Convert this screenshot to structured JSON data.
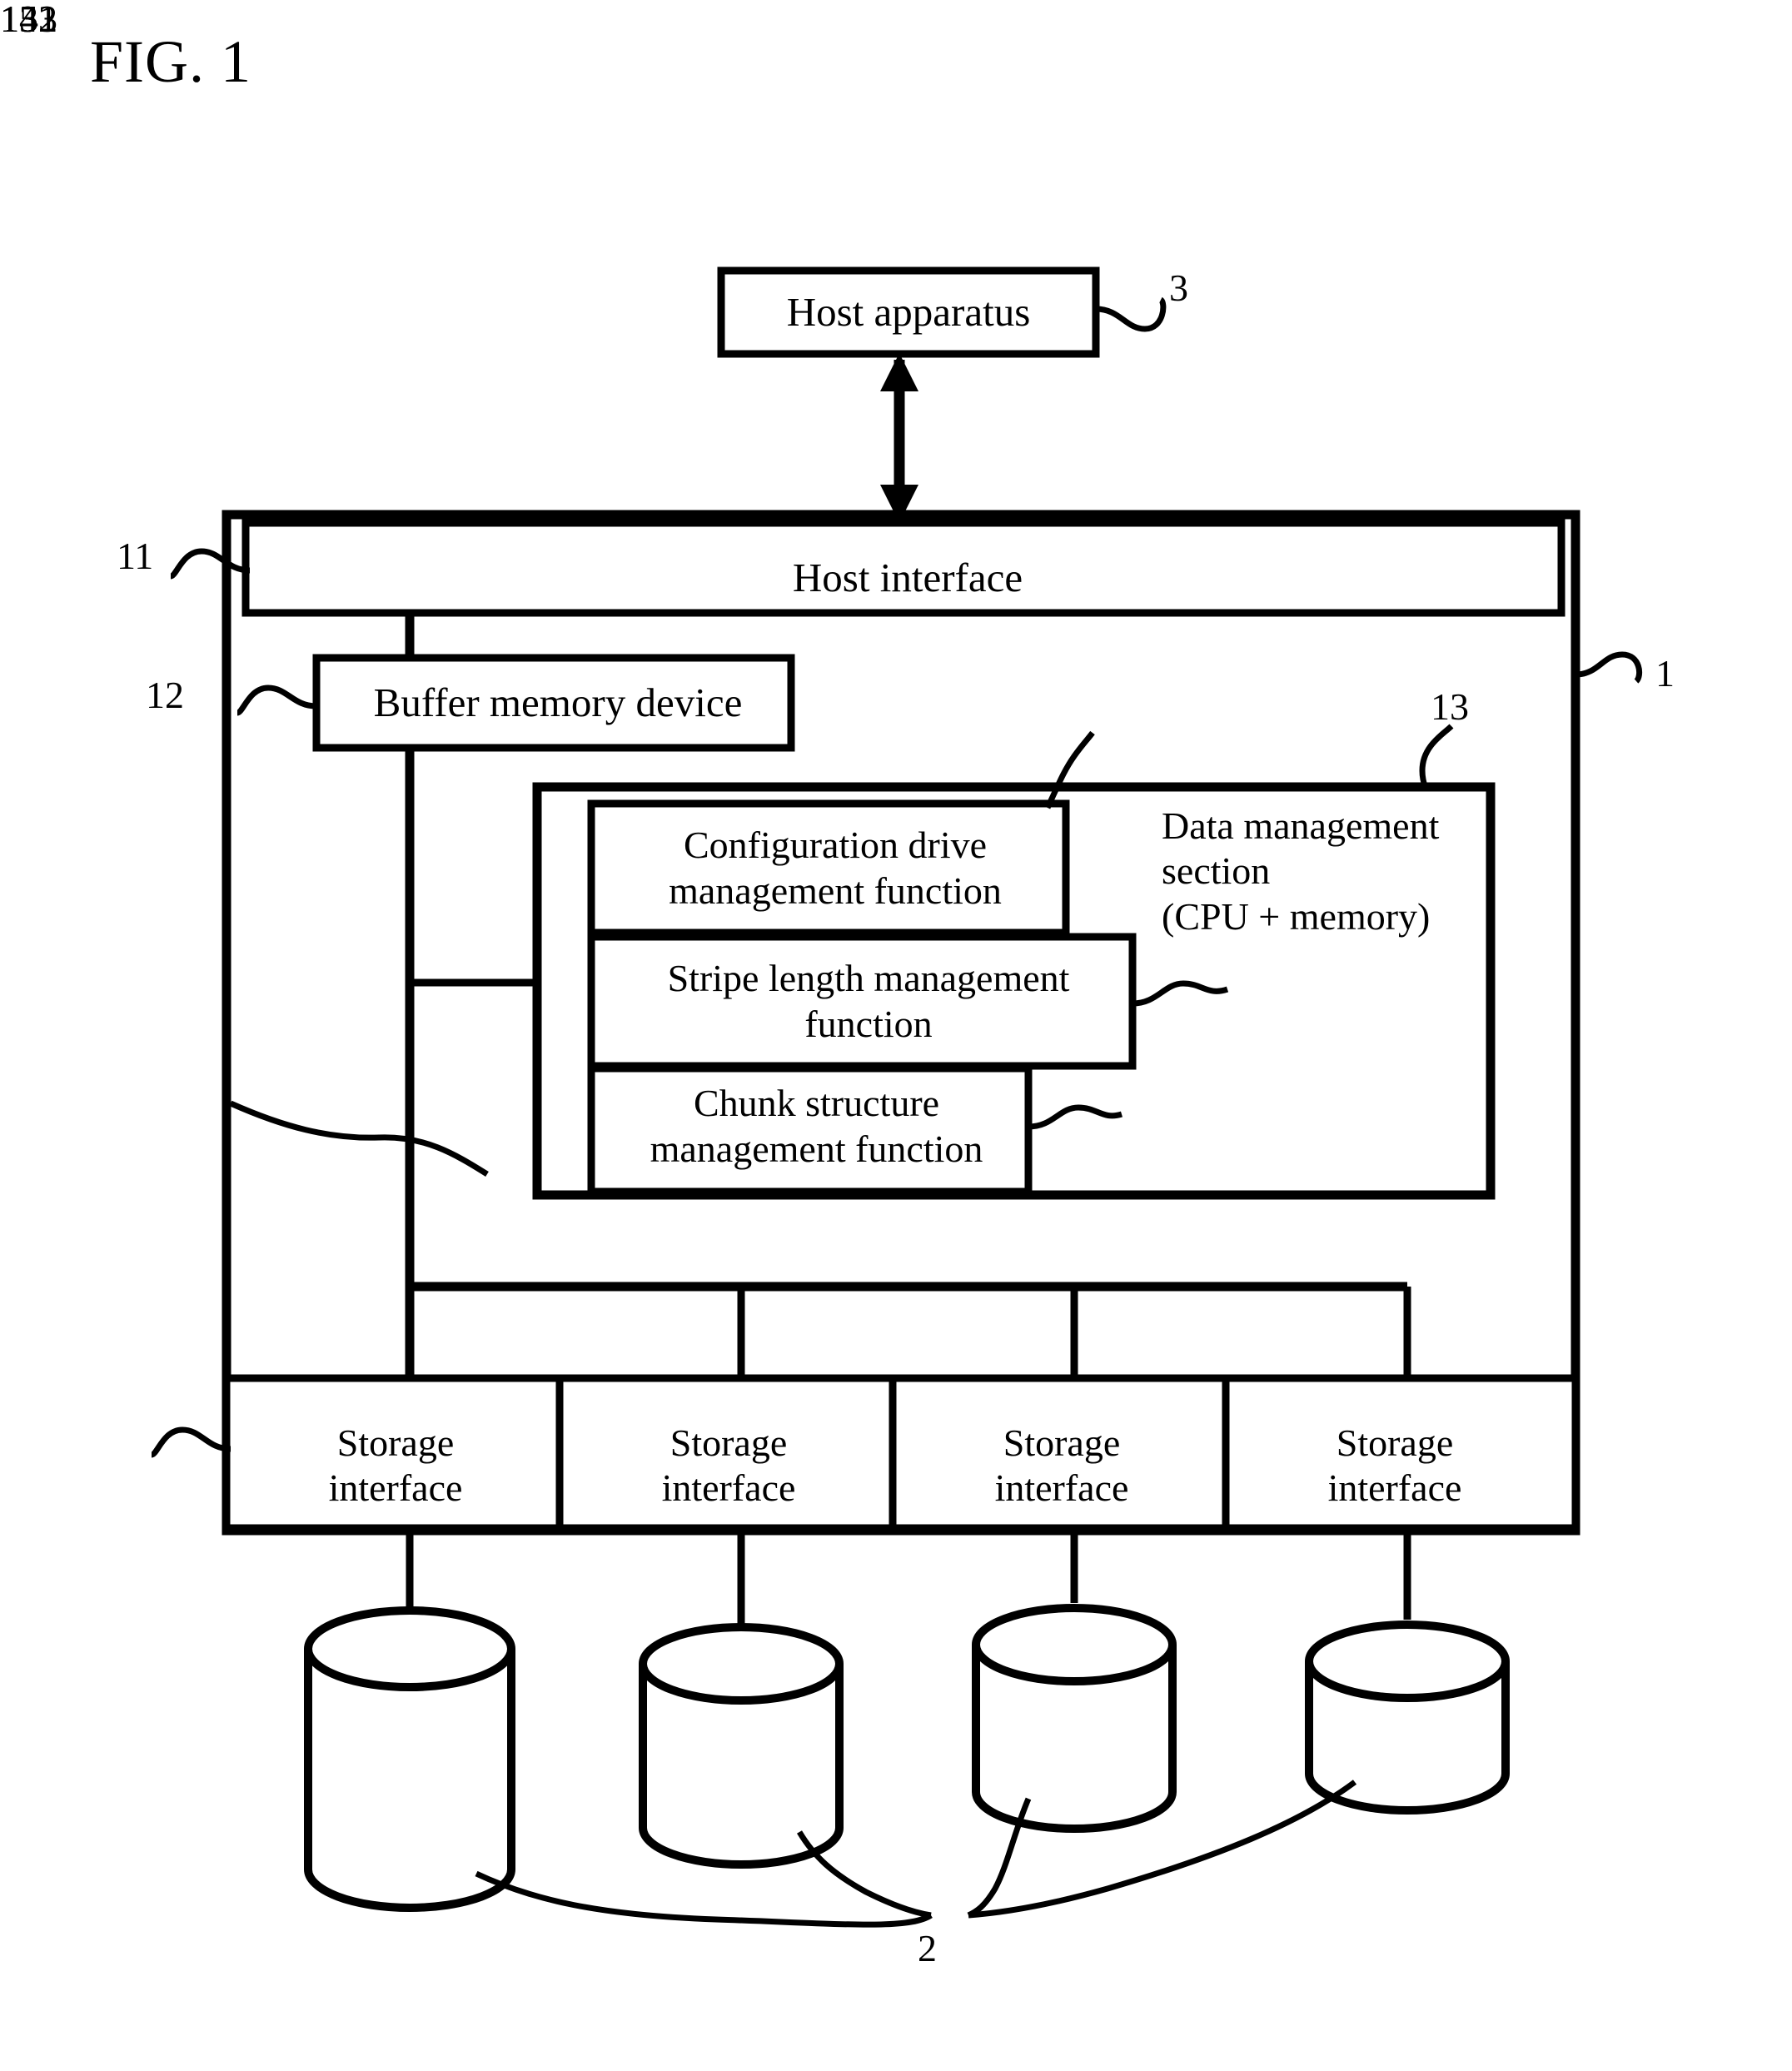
{
  "figure": {
    "title": "FIG. 1"
  },
  "blocks": {
    "host_apparatus": "Host apparatus",
    "host_interface": "Host interface",
    "buffer_memory_device": "Buffer memory device",
    "data_management_section": "Data management\nsection\n(CPU + memory)",
    "configuration_drive_management_function": "Configuration drive\nmanagement function",
    "stripe_length_management_function": "Stripe length management\nfunction",
    "chunk_structure_management_function": "Chunk structure\nmanagement function",
    "storage_interface_1": "Storage\ninterface",
    "storage_interface_2": "Storage\ninterface",
    "storage_interface_3": "Storage\ninterface",
    "storage_interface_4": "Storage\ninterface"
  },
  "reference_numerals": {
    "storage_apparatus": "1",
    "storage_drives": "2",
    "host_apparatus": "3",
    "host_interface": "11",
    "buffer_memory_device": "12",
    "data_management_section": "13",
    "configuration_drive_management_function": "131",
    "stripe_length_management_function": "132",
    "chunk_structure_management_function": "133",
    "storage_interface": "14",
    "internal_bus": "15"
  },
  "colors": {
    "line": "#000000",
    "background": "#ffffff"
  }
}
